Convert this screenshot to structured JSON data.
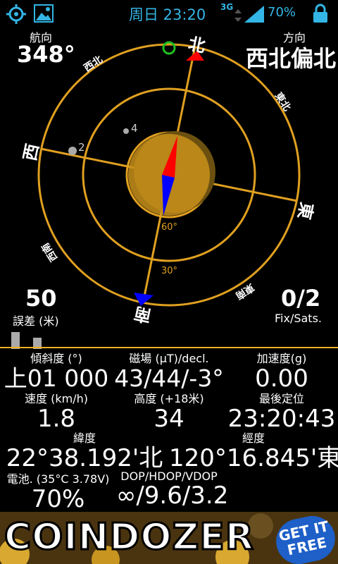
{
  "status_bar": {
    "time": "周日 23:20",
    "network": "3G",
    "battery": "70%"
  },
  "compass": {
    "heading_label": "航向",
    "heading_value": "348°",
    "direction_label": "方向",
    "direction_value": "西北偏北",
    "cardinals": {
      "north": "北",
      "south": "南",
      "east": "東",
      "west": "西"
    },
    "intercardinals": {
      "northwest": "西北",
      "northeast": "東北",
      "southwest": "西南",
      "southeast": "東南"
    },
    "elevation_rings": [
      "60°",
      "30°"
    ],
    "satellites": [
      {
        "id": "2",
        "label": "2"
      },
      {
        "id": "4",
        "label": "4"
      }
    ],
    "error_value": "50",
    "error_label": "誤差 (米)",
    "fix_value": "0/2",
    "fix_label": "Fix/Sats."
  },
  "readings": {
    "tilt_label": "傾斜度 (°)",
    "tilt_value": "上01 000",
    "magnetic_label": "磁場 (µT)/decl.",
    "magnetic_value": "43/44/-3°",
    "accel_label": "加速度(g)",
    "accel_value": "0.00",
    "speed_label": "速度 (km/h)",
    "speed_value": "1.8",
    "altitude_label": "高度 (+18米)",
    "altitude_value": "34",
    "lastfix_label": "最後定位",
    "lastfix_value": "23:20:43",
    "lat_label": "緯度",
    "lat_value": "22°38.192'北",
    "lon_label": "經度",
    "lon_value": "120°16.845'東",
    "battery_label": "電池. (35°C 3.78V)",
    "battery_value": "70%",
    "dop_label": "DOP/HDOP/VDOP",
    "dop_value": "∞/9.6/3.2"
  },
  "ad": {
    "title": "COINDOZER",
    "cta": "GET IT FREE"
  },
  "colors": {
    "ring": "#e0a020",
    "accent": "#33b5e5",
    "needle_north": "#ff0000",
    "needle_south": "#0000ff"
  }
}
